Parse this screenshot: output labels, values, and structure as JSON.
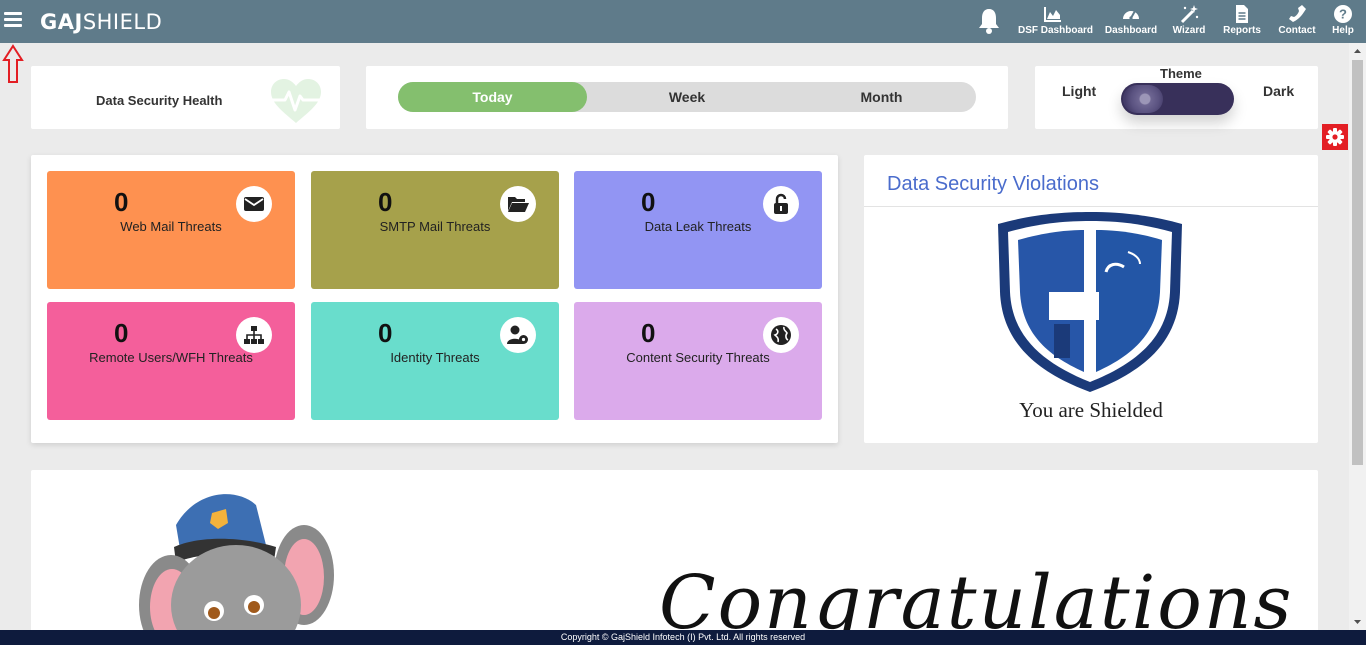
{
  "brand": {
    "part1": "GAJ",
    "part2": "SHIELD"
  },
  "nav": {
    "items": [
      {
        "label": "DSF Dashboard",
        "icon": "area-chart-icon"
      },
      {
        "label": "Dashboard",
        "icon": "speedometer-icon"
      },
      {
        "label": "Wizard",
        "icon": "magic-wand-icon"
      },
      {
        "label": "Reports",
        "icon": "document-icon"
      },
      {
        "label": "Contact",
        "icon": "phone-icon"
      },
      {
        "label": "Help",
        "icon": "help-icon"
      }
    ]
  },
  "health": {
    "title": "Data Security Health"
  },
  "period": {
    "today": "Today",
    "week": "Week",
    "month": "Month",
    "active": "Today",
    "active_color": "#84bf6e"
  },
  "theme": {
    "label": "Theme",
    "light": "Light",
    "dark": "Dark",
    "selected": "Dark"
  },
  "threats": [
    {
      "count": "0",
      "name": "Web Mail Threats",
      "color": "#fe9150",
      "icon": "envelope-icon"
    },
    {
      "count": "0",
      "name": "SMTP Mail Threats",
      "color": "#a6a14b",
      "icon": "folder-open-icon"
    },
    {
      "count": "0",
      "name": "Data Leak Threats",
      "color": "#9295f3",
      "icon": "unlock-icon"
    },
    {
      "count": "0",
      "name": "Remote Users/WFH Threats",
      "color": "#f45f9b",
      "icon": "sitemap-icon"
    },
    {
      "count": "0",
      "name": "Identity Threats",
      "color": "#69ddcc",
      "icon": "user-gear-icon"
    },
    {
      "count": "0",
      "name": "Content Security Threats",
      "color": "#dbaaeb",
      "icon": "globe-icon"
    }
  ],
  "violations": {
    "title": "Data Security Violations",
    "status": "You are Shielded"
  },
  "congrats": {
    "text": "Congratulations"
  },
  "footer": {
    "copyright": "Copyright © GajShield Infotech (I) Pvt. Ltd. All rights reserved"
  }
}
